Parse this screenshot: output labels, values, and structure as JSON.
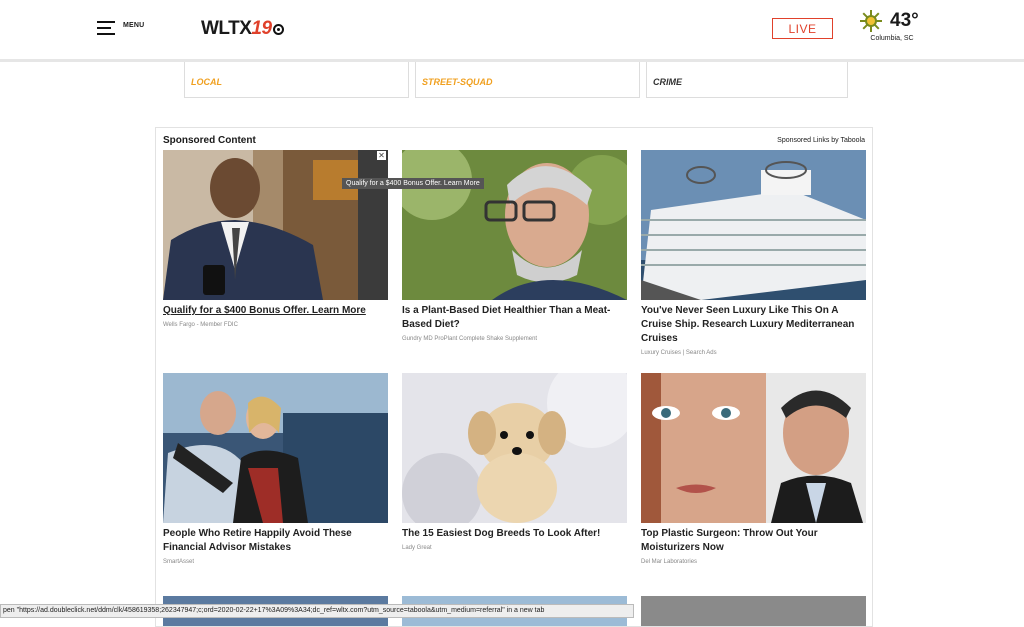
{
  "header": {
    "menu_label": "MENU",
    "logo_text": "WLTX",
    "logo_number": "19",
    "live_label": "LIVE",
    "weather": {
      "temperature": "43°",
      "city": "Columbia, SC",
      "icon": "sun-icon"
    }
  },
  "categories": [
    {
      "label": "LOCAL",
      "color": "#f0a020"
    },
    {
      "label": "STREET-SQUAD",
      "color": "#f0a020"
    },
    {
      "label": "CRIME",
      "color": "#333333"
    }
  ],
  "sponsored": {
    "title": "Sponsored Content",
    "by": "Sponsored Links by Taboola",
    "tooltip": "Qualify for a $400 Bonus Offer. Learn More",
    "items": [
      {
        "headline": "Qualify for a $400 Bonus Offer. Learn More",
        "source": "Wells Fargo - Member FDIC"
      },
      {
        "headline": "Is a Plant-Based Diet Healthier Than a Meat-Based Diet?",
        "source": "Gundry MD ProPlant Complete Shake Supplement"
      },
      {
        "headline": "You've Never Seen Luxury Like This On A Cruise Ship. Research Luxury Mediterranean Cruises",
        "source": "Luxury Cruises | Search Ads"
      },
      {
        "headline": "People Who Retire Happily Avoid These Financial Advisor Mistakes",
        "source": "SmartAsset"
      },
      {
        "headline": "The 15 Easiest Dog Breeds To Look After!",
        "source": "Lady Great"
      },
      {
        "headline": "Top Plastic Surgeon: Throw Out Your Moisturizers Now",
        "source": "Del Mar Laboratories"
      }
    ]
  },
  "status_bar": "pen \"https://ad.doubleclick.net/ddm/clk/458619358;262347947;c;ord=2020-02-22+17%3A09%3A34;dc_ref=wltx.com?utm_source=taboola&utm_medium=referral\" in a new tab"
}
